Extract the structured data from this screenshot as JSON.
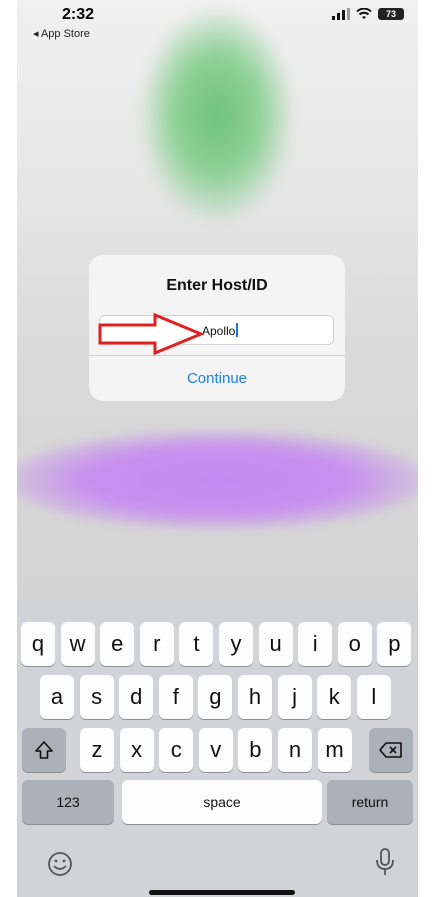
{
  "status_bar": {
    "time": "2:32",
    "back_label": "◂ App Store",
    "battery": "73"
  },
  "dialog": {
    "title": "Enter Host/ID",
    "input_value": "Apollo",
    "continue_label": "Continue"
  },
  "keyboard": {
    "row1": [
      "q",
      "w",
      "e",
      "r",
      "t",
      "y",
      "u",
      "i",
      "o",
      "p"
    ],
    "row2": [
      "a",
      "s",
      "d",
      "f",
      "g",
      "h",
      "j",
      "k",
      "l"
    ],
    "row3": [
      "z",
      "x",
      "c",
      "v",
      "b",
      "n",
      "m"
    ],
    "numbers_label": "123",
    "space_label": "space",
    "return_label": "return",
    "shift_icon": "shift-icon",
    "backspace_icon": "backspace-icon",
    "emoji_icon": "emoji-icon",
    "mic_icon": "microphone-icon"
  },
  "colors": {
    "accent": "#1e7fe0",
    "annotation_arrow": "#e02020",
    "keyboard_bg": "#d1d3d8"
  }
}
